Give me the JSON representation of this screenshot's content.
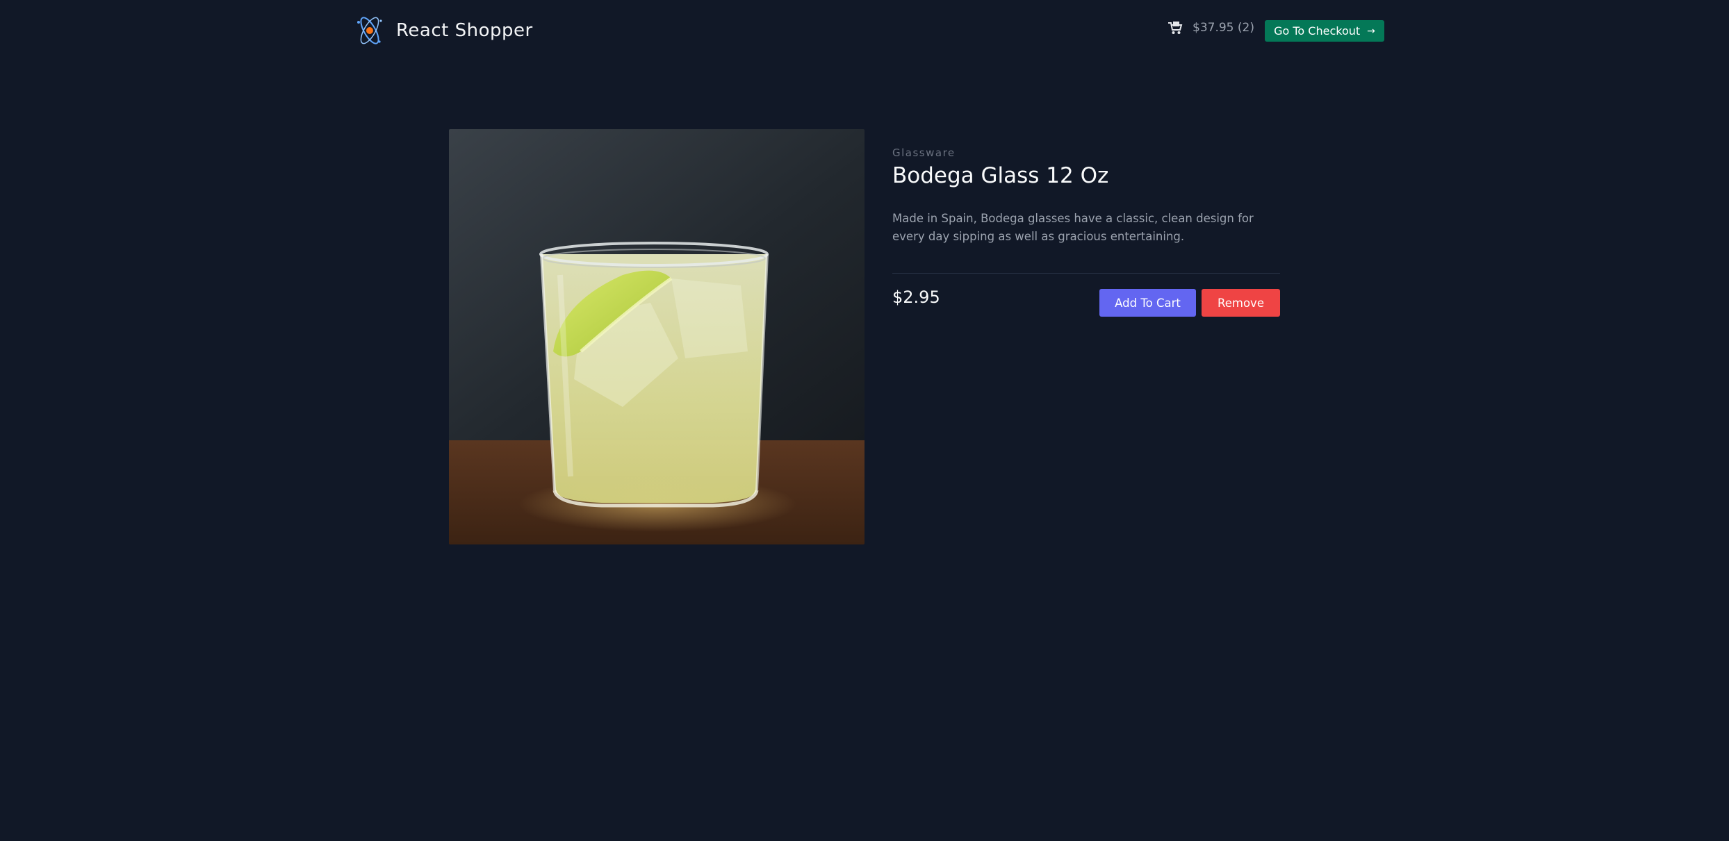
{
  "header": {
    "brand_name": "React Shopper",
    "logo_icon": "atom-logo-icon",
    "cart": {
      "icon": "shopping-cart-icon",
      "summary": "$37.95 (2)"
    },
    "checkout": {
      "label": "Go To Checkout",
      "arrow": "→"
    }
  },
  "product": {
    "category": "Glassware",
    "title": "Bodega Glass 12 Oz",
    "description": "Made in Spain, Bodega glasses have a classic, clean design for every day sipping as well as gracious entertaining.",
    "price": "$2.95",
    "image_alt": "glass-with-lemonade-and-lime"
  },
  "actions": {
    "add_to_cart_label": "Add To Cart",
    "remove_label": "Remove"
  },
  "colors": {
    "background": "#111827",
    "checkout_button": "#047857",
    "add_button": "#6366f1",
    "remove_button": "#ef4444"
  }
}
